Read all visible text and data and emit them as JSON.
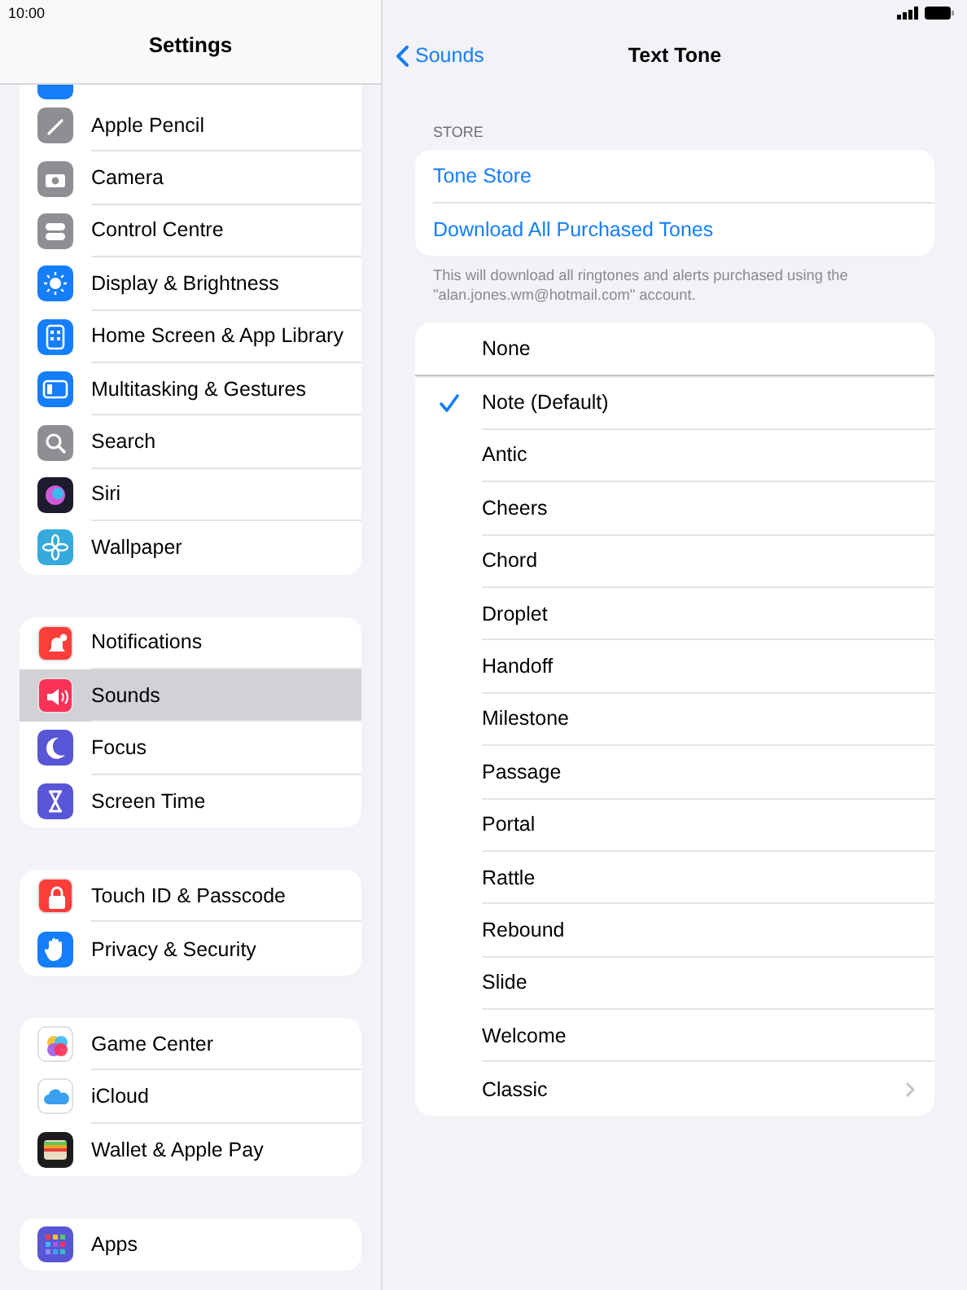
{
  "status_bar": {
    "time": "10:00"
  },
  "sidebar": {
    "title": "Settings",
    "groups": [
      {
        "items": [
          {
            "label": "Apple Pencil",
            "color": "#8e8e93",
            "selected": false
          },
          {
            "label": "Camera",
            "color": "#8e8e93",
            "selected": false
          },
          {
            "label": "Control Centre",
            "color": "#8e8e93",
            "selected": false
          },
          {
            "label": "Display & Brightness",
            "color": "#147efb",
            "selected": false
          },
          {
            "label": "Home Screen & App Library",
            "color": "#147efb",
            "selected": false
          },
          {
            "label": "Multitasking & Gestures",
            "color": "#147efb",
            "selected": false
          },
          {
            "label": "Search",
            "color": "#8e8e93",
            "selected": false
          },
          {
            "label": "Siri",
            "color": "#1c1c2e",
            "selected": false
          },
          {
            "label": "Wallpaper",
            "color": "#35aadc",
            "selected": false
          }
        ]
      },
      {
        "items": [
          {
            "label": "Notifications",
            "color": "#fc3d39",
            "selected": false
          },
          {
            "label": "Sounds",
            "color": "#fc3158",
            "selected": true
          },
          {
            "label": "Focus",
            "color": "#5856d6",
            "selected": false
          },
          {
            "label": "Screen Time",
            "color": "#5856d6",
            "selected": false
          }
        ]
      },
      {
        "items": [
          {
            "label": "Touch ID & Passcode",
            "color": "#fc3d39",
            "selected": false
          },
          {
            "label": "Privacy & Security",
            "color": "#147efb",
            "selected": false
          }
        ]
      },
      {
        "items": [
          {
            "label": "Game Center",
            "color": "#ffffff",
            "selected": false
          },
          {
            "label": "iCloud",
            "color": "#ffffff",
            "selected": false
          },
          {
            "label": "Wallet & Apple Pay",
            "color": "#1c1c1e",
            "selected": false
          }
        ]
      },
      {
        "items": [
          {
            "label": "Apps",
            "color": "#5856d6",
            "selected": false
          }
        ]
      }
    ]
  },
  "detail": {
    "back": "Sounds",
    "title": "Text Tone",
    "store_header": "STORE",
    "store_links": [
      "Tone Store",
      "Download All Purchased Tones"
    ],
    "store_footer": "This will download all ringtones and alerts purchased using the \"alan.jones.wm@hotmail.com\" account.",
    "tones": [
      {
        "label": "None",
        "selected": false,
        "kind": "tone"
      },
      {
        "label": "Note (Default)",
        "selected": true,
        "kind": "tone"
      },
      {
        "label": "Antic",
        "selected": false,
        "kind": "tone"
      },
      {
        "label": "Cheers",
        "selected": false,
        "kind": "tone"
      },
      {
        "label": "Chord",
        "selected": false,
        "kind": "tone"
      },
      {
        "label": "Droplet",
        "selected": false,
        "kind": "tone"
      },
      {
        "label": "Handoff",
        "selected": false,
        "kind": "tone"
      },
      {
        "label": "Milestone",
        "selected": false,
        "kind": "tone"
      },
      {
        "label": "Passage",
        "selected": false,
        "kind": "tone"
      },
      {
        "label": "Portal",
        "selected": false,
        "kind": "tone"
      },
      {
        "label": "Rattle",
        "selected": false,
        "kind": "tone"
      },
      {
        "label": "Rebound",
        "selected": false,
        "kind": "tone"
      },
      {
        "label": "Slide",
        "selected": false,
        "kind": "tone"
      },
      {
        "label": "Welcome",
        "selected": false,
        "kind": "tone"
      },
      {
        "label": "Classic",
        "selected": false,
        "kind": "submenu"
      }
    ]
  }
}
